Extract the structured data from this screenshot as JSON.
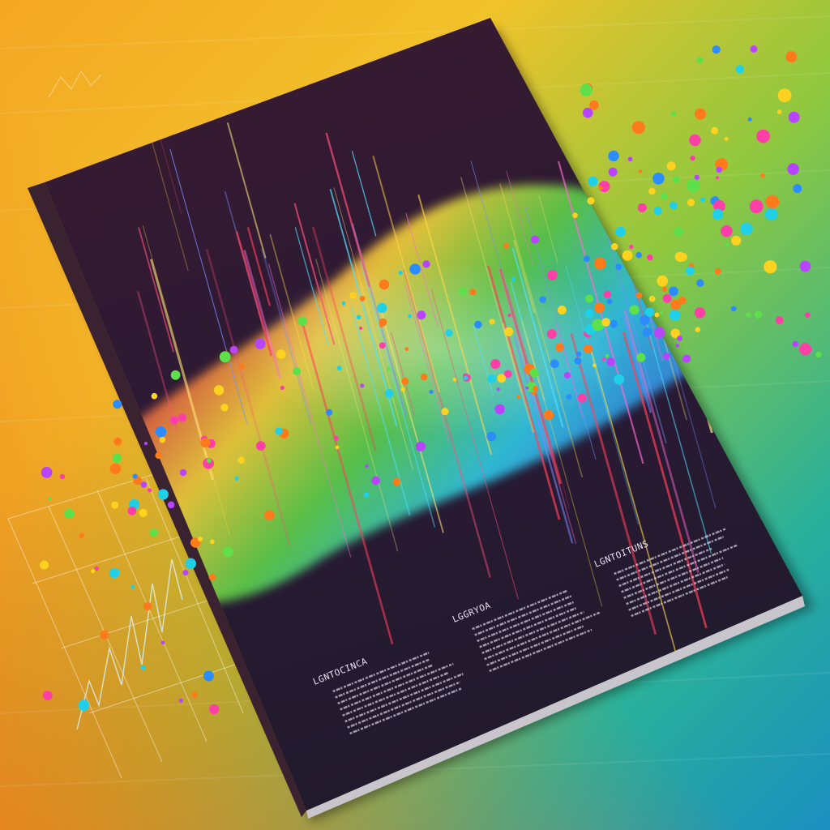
{
  "scene": {
    "description_tag": "book-cover-illustration",
    "colors": {
      "table_orange": "#f08a1e",
      "table_yellow": "#f2c22a",
      "table_green": "#5fbf4a",
      "table_teal": "#1f9fbf",
      "cover_dark": "#2b1a2e",
      "spectrum_red": "#e0304a",
      "spectrum_magenta": "#e0319a",
      "spectrum_yellow": "#f4d23a",
      "spectrum_green": "#5dd14a",
      "spectrum_cyan": "#2fc8e6",
      "spectrum_blue": "#3a5fe0",
      "dot_colors": [
        "#1fd0e8",
        "#ff3fa8",
        "#ffd21f",
        "#5ee04a",
        "#ff7a1a",
        "#b844ff",
        "#2a8cff"
      ]
    }
  },
  "cover": {
    "labels": [
      {
        "text": "LGNTOCINCA"
      },
      {
        "text": "LGGRYOA"
      },
      {
        "text": "LGNTOITUNS"
      }
    ]
  }
}
